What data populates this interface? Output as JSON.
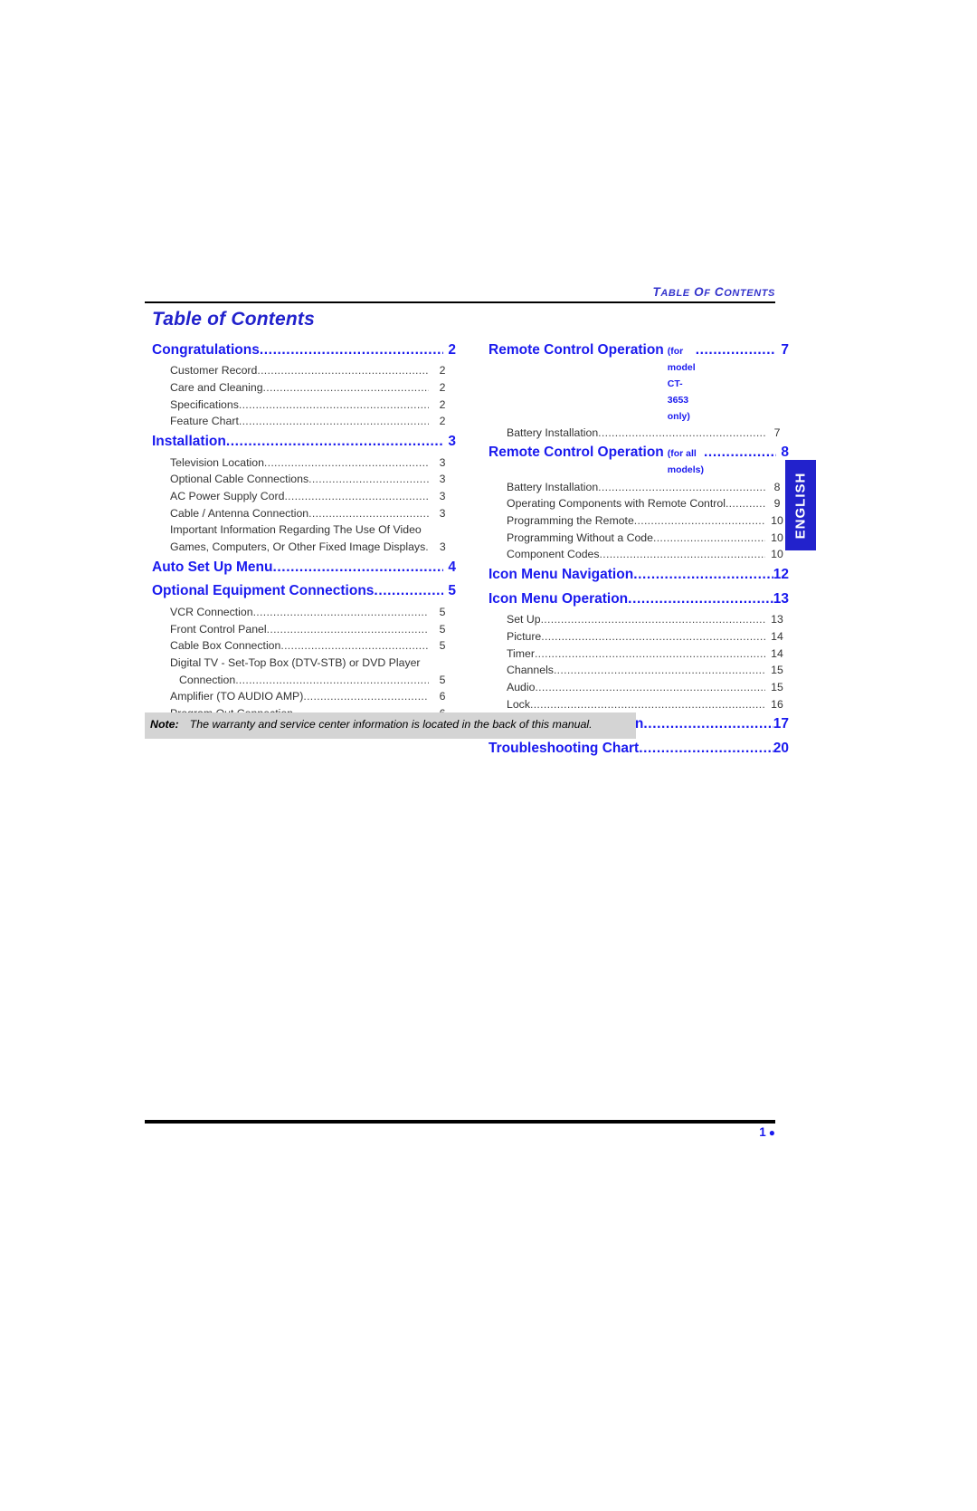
{
  "running_head": {
    "lead": "T",
    "rest_1": "ABLE OF ",
    "lead_2": "C",
    "rest_2": "ONTENTS",
    "full": "TABLE OF CONTENTS"
  },
  "title": "Table of Contents",
  "side_tab": {
    "label": "ENGLISH"
  },
  "leader_dots": "..................................................................................................................................................",
  "left_column": [
    {
      "type": "main",
      "label": "Congratulations",
      "page": "2"
    },
    {
      "type": "sub",
      "label": "Customer Record",
      "page": "2"
    },
    {
      "type": "sub",
      "label": "Care and Cleaning",
      "page": "2"
    },
    {
      "type": "sub",
      "label": "Specifications",
      "page": "2"
    },
    {
      "type": "sub",
      "label": "Feature Chart",
      "page": "2"
    },
    {
      "type": "main",
      "label": "Installation",
      "page": "3"
    },
    {
      "type": "sub",
      "label": "Television Location",
      "page": "3"
    },
    {
      "type": "sub",
      "label": "Optional Cable Connections",
      "page": "3"
    },
    {
      "type": "sub",
      "label": "AC Power Supply Cord",
      "page": "3"
    },
    {
      "type": "sub",
      "label": "Cable / Antenna Connection",
      "page": "3"
    },
    {
      "type": "plain",
      "label": "Important Information Regarding The Use Of Video"
    },
    {
      "type": "sub",
      "label": "Games, Computers, Or Other Fixed Image Displays",
      "page": "3",
      "short_leader": true
    },
    {
      "type": "main",
      "label": "Auto Set Up Menu",
      "page": "4"
    },
    {
      "type": "main",
      "label": "Optional Equipment Connections",
      "page": "5"
    },
    {
      "type": "sub",
      "label": "VCR Connection",
      "page": "5"
    },
    {
      "type": "sub",
      "label": "Front Control Panel",
      "page": "5"
    },
    {
      "type": "sub",
      "label": "Cable Box Connection",
      "page": "5"
    },
    {
      "type": "plain",
      "label": "Digital TV - Set-Top Box (DTV-STB) or DVD Player"
    },
    {
      "type": "sub",
      "label": "Connection",
      "page": "5",
      "indent2": true
    },
    {
      "type": "sub",
      "label": "Amplifier (TO AUDIO AMP)",
      "page": "6"
    },
    {
      "type": "sub",
      "label": "Program Out Connection",
      "page": "6"
    }
  ],
  "right_column": [
    {
      "type": "main",
      "label": "Remote Control Operation",
      "note": "(for model CT-3653 only)",
      "page": "7"
    },
    {
      "type": "sub",
      "label": "Battery Installation",
      "page": "7"
    },
    {
      "type": "main",
      "label": "Remote Control Operation",
      "note": "(for all models)",
      "page": "8"
    },
    {
      "type": "sub",
      "label": "Battery Installation",
      "page": "8"
    },
    {
      "type": "sub",
      "label": "Operating Components with Remote Control",
      "page": "9"
    },
    {
      "type": "sub",
      "label": "Programming the Remote",
      "page": "10"
    },
    {
      "type": "sub",
      "label": "Programming Without a Code",
      "page": "10"
    },
    {
      "type": "sub",
      "label": "Component Codes",
      "page": "10"
    },
    {
      "type": "main",
      "label": "Icon Menu Navigation",
      "page": "12"
    },
    {
      "type": "main",
      "label": "Icon Menu Operation",
      "page": "13"
    },
    {
      "type": "sub",
      "label": "Set Up",
      "page": "13"
    },
    {
      "type": "sub",
      "label": "Picture",
      "page": "14"
    },
    {
      "type": "sub",
      "label": "Timer",
      "page": "14"
    },
    {
      "type": "sub",
      "label": "Channels",
      "page": "15"
    },
    {
      "type": "sub",
      "label": "Audio",
      "page": "15"
    },
    {
      "type": "sub",
      "label": "Lock",
      "page": "16"
    },
    {
      "type": "main",
      "label": "V-Chip Menu Operation",
      "page": "17"
    },
    {
      "type": "main",
      "label": "Troubleshooting Chart",
      "page": "20"
    }
  ],
  "note": {
    "label": "Note:",
    "text": "The warranty and service center information is located in the back of  this manual."
  },
  "footer": {
    "page_number": "1",
    "bullet": "●"
  },
  "colors": {
    "accent_blue": "#1a1aee",
    "title_blue": "#2222cc",
    "note_bg": "#d4d4d4",
    "rule_black": "#000000"
  }
}
